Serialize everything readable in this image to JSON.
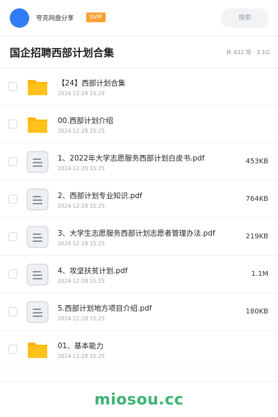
{
  "header": {
    "share_name": "夸克网盘分享",
    "badge": "SVIP",
    "search_placeholder": "搜索"
  },
  "title_bar": {
    "title": "国企招聘西部计划合集",
    "meta": "共 432 项 · 3.1G"
  },
  "files": [
    {
      "type": "folder",
      "name": "【24】西部计划合集",
      "date": "2024-12-28 15:29",
      "size": ""
    },
    {
      "type": "folder",
      "name": "00.西部计划介绍",
      "date": "2024-12-28 15:25",
      "size": ""
    },
    {
      "type": "document",
      "name": "1、2022年大学志愿服务西部计划白皮书.pdf",
      "date": "2024-12-28 15:25",
      "size": "453KB"
    },
    {
      "type": "document",
      "name": "2、西部计划专业知识.pdf",
      "date": "2024-12-28 15:25",
      "size": "764KB"
    },
    {
      "type": "document",
      "name": "3、大学生志愿服务西部计划志愿者管理办法.pdf",
      "date": "2024-12-28 15:25",
      "size": "219KB"
    },
    {
      "type": "document",
      "name": "4、攻坚扶贫计划.pdf",
      "date": "2024-12-28 15:25",
      "size": "1.1M"
    },
    {
      "type": "document",
      "name": "5.西部计划地方项目介绍.pdf",
      "date": "2024-12-28 15:25",
      "size": "180KB"
    },
    {
      "type": "folder",
      "name": "01、基本能力",
      "date": "2024-12-28 15:25",
      "size": ""
    }
  ],
  "footer": {
    "watermark": "miosou.cc"
  },
  "colors": {
    "avatar": "#2f7cf6",
    "badge": "#f7a233",
    "folder": "#ffc21a",
    "watermark": "#3cb371"
  },
  "icons": {
    "folder": "folder-icon",
    "document": "document-icon"
  }
}
